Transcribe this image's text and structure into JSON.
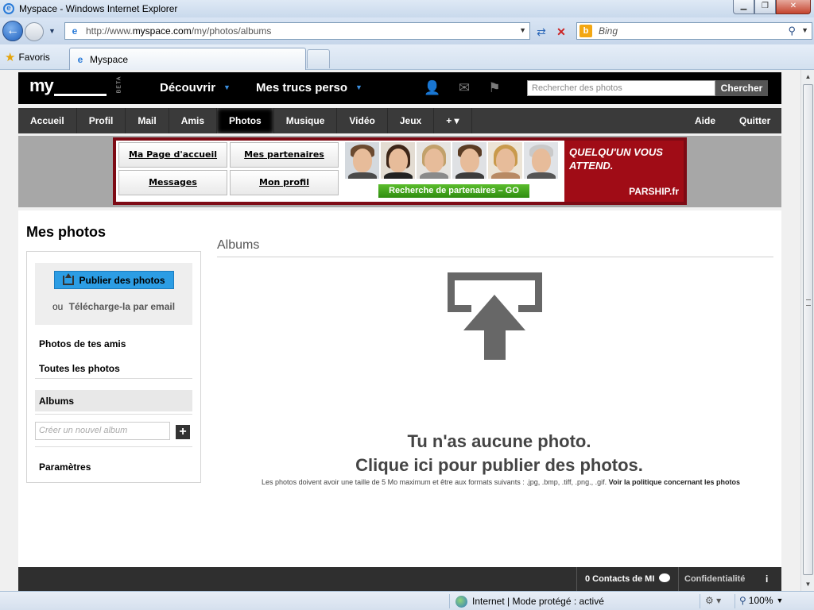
{
  "window": {
    "title": "Myspace - Windows Internet Explorer",
    "min_label": "▁",
    "max_label": "❐",
    "close_label": "✕"
  },
  "toolbar": {
    "back_label": "←",
    "url_prefix": "http://www.",
    "url_domain": "myspace.com",
    "url_path": "/my/photos/albums",
    "search_placeholder": "Bing",
    "refresh_label": "⇄",
    "stop_label": "✕"
  },
  "favorites": {
    "label": "Favoris",
    "tab_title": "Myspace"
  },
  "header": {
    "logo": "my",
    "beta": "BETA",
    "discover": "Découvrir",
    "my_stuff": "Mes trucs perso",
    "search_placeholder": "Rechercher des photos",
    "search_button": "Chercher"
  },
  "subnav": {
    "items": [
      "Accueil",
      "Profil",
      "Mail",
      "Amis",
      "Photos",
      "Musique",
      "Vidéo",
      "Jeux",
      "+ ▾"
    ],
    "active": "Photos",
    "help": "Aide",
    "quit": "Quitter"
  },
  "ad": {
    "btn_home": "Ma Page d'accueil",
    "btn_partners": "Mes partenaires",
    "btn_messages": "Messages",
    "btn_profile": "Mon profil",
    "go_button": "Recherche de partenaires – GO",
    "tagline": "QUELQU'UN VOUS ATTEND.",
    "brand": "PARSHIP.fr"
  },
  "sidebar": {
    "page_title": "Mes photos",
    "publish_button": "Publier des photos",
    "or": "ou",
    "email_upload": "Télécharge-la par email",
    "friends_photos": "Photos de tes amis",
    "all_photos": "Toutes les photos",
    "albums": "Albums",
    "new_album_placeholder": "Créer un nouvel album",
    "add_label": "+",
    "settings": "Paramètres"
  },
  "main": {
    "title": "Albums",
    "empty_line1": "Tu n'as aucune photo.",
    "empty_line2": "Clique ici pour publier des photos.",
    "note": "Les photos doivent avoir une taille de 5 Mo maximum et être aux formats suivants : .jpg, .bmp, .tiff, .png., .gif.",
    "policy_link": "Voir la politique concernant les photos"
  },
  "footer": {
    "contacts": "0 Contacts de MI",
    "privacy": "Confidentialité",
    "info": "i"
  },
  "status": {
    "zone": "Internet | Mode protégé : activé",
    "zoom": "100%"
  },
  "colors": {
    "ms_black": "#000000",
    "subnav": "#3a3a3a",
    "publish_blue": "#2c9de4",
    "parship_red": "#a00c16",
    "go_green": "#2f8d10"
  }
}
